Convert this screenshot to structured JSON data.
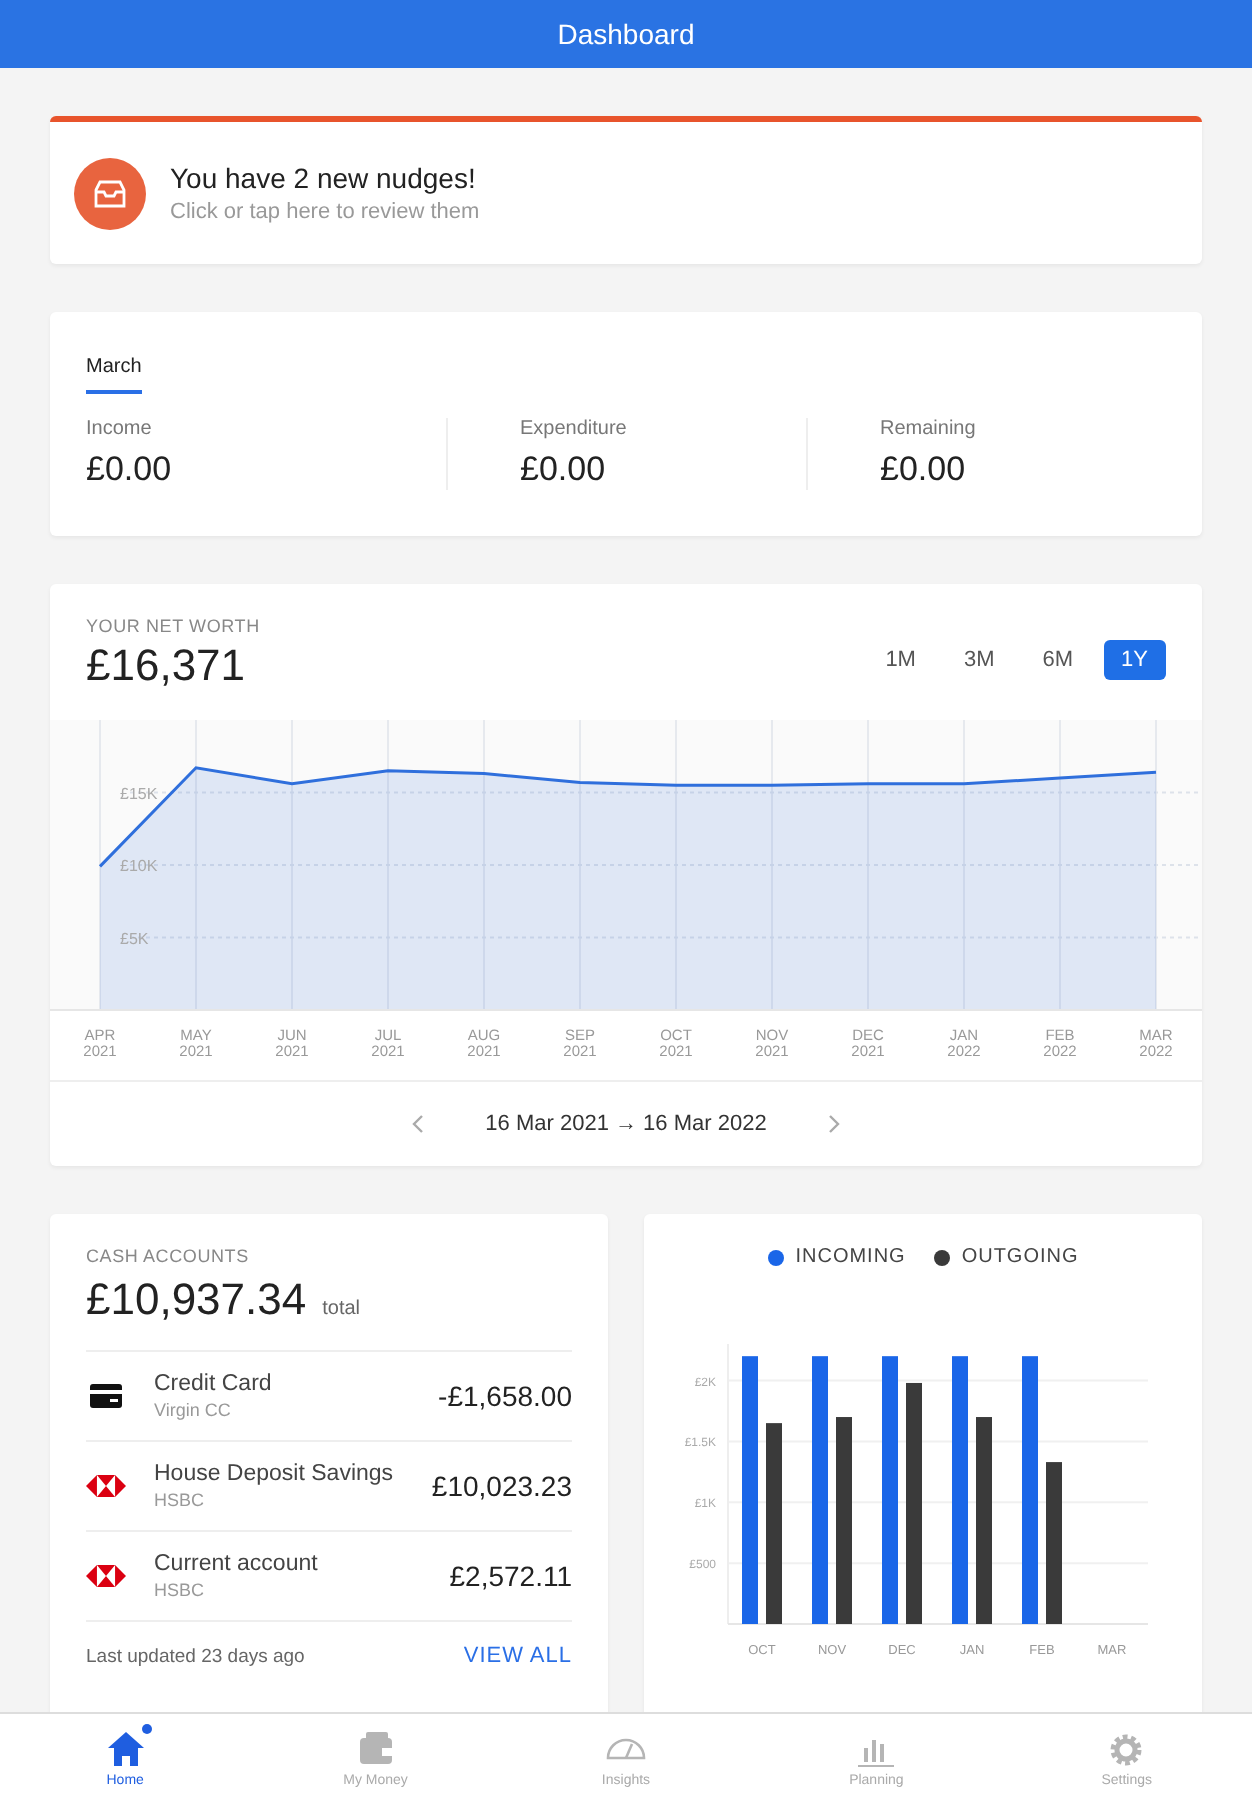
{
  "header": {
    "title": "Dashboard"
  },
  "nudge": {
    "title": "You have 2 new nudges!",
    "subtitle": "Click or tap here to review them"
  },
  "summary": {
    "tabs": [
      {
        "label": "March",
        "selected": true
      }
    ],
    "stats": [
      {
        "label": "Income",
        "value": "£0.00"
      },
      {
        "label": "Expenditure",
        "value": "£0.00"
      },
      {
        "label": "Remaining",
        "value": "£0.00"
      }
    ]
  },
  "net_worth": {
    "label": "YOUR NET WORTH",
    "value": "£16,371",
    "ranges": [
      {
        "label": "1M",
        "selected": false
      },
      {
        "label": "3M",
        "selected": false
      },
      {
        "label": "6M",
        "selected": false
      },
      {
        "label": "1Y",
        "selected": true
      }
    ],
    "chart_data": {
      "type": "area",
      "categories": [
        "APR 2021",
        "MAY 2021",
        "JUN 2021",
        "JUL 2021",
        "AUG 2021",
        "SEP 2021",
        "OCT 2021",
        "NOV 2021",
        "DEC 2021",
        "JAN 2022",
        "FEB 2022",
        "MAR 2022"
      ],
      "grid": true,
      "series": [
        {
          "color": "#2f6fdc",
          "values": [
            9900,
            16700,
            15600,
            16500,
            16300,
            15700,
            15500,
            15500,
            15600,
            15600,
            16000,
            16400
          ]
        }
      ],
      "ylim": [
        0,
        20000
      ],
      "yticks": [
        {
          "value": 5000,
          "label": "£5K"
        },
        {
          "value": 10000,
          "label": "£10K"
        },
        {
          "value": 15000,
          "label": "£15K"
        }
      ]
    },
    "date_range": "16 Mar 2021 → 16 Mar 2022"
  },
  "cash_accounts": {
    "label": "CASH ACCOUNTS",
    "total": "£10,937.34",
    "total_suffix": "total",
    "accounts": [
      {
        "kind": "card",
        "name": "Credit Card",
        "provider": "Virgin CC",
        "balance": "-£1,658.00"
      },
      {
        "kind": "bank",
        "name": "House Deposit Savings",
        "provider": "HSBC",
        "balance": "£10,023.23"
      },
      {
        "kind": "bank",
        "name": "Current account",
        "provider": "HSBC",
        "balance": "£2,572.11"
      }
    ],
    "updated": "Last updated 23 days ago",
    "link": "VIEW ALL"
  },
  "cash_flow": {
    "chart_data": {
      "type": "bar",
      "grid": true,
      "legend": "top",
      "categories": [
        "OCT",
        "NOV",
        "DEC",
        "JAN",
        "FEB",
        "MAR"
      ],
      "series": [
        {
          "name": "INCOMING",
          "color": "#1a66e8",
          "values": [
            2200,
            2200,
            2200,
            2200,
            2200,
            null
          ]
        },
        {
          "name": "OUTGOING",
          "color": "#3a3a3a",
          "values": [
            1650,
            1700,
            1980,
            1700,
            1330,
            null
          ]
        }
      ],
      "ylim": [
        0,
        2300
      ],
      "yticks": [
        {
          "value": 500,
          "label": "£500"
        },
        {
          "value": 1000,
          "label": "£1K"
        },
        {
          "value": 1500,
          "label": "£1.5K"
        },
        {
          "value": 2000,
          "label": "£2K"
        }
      ]
    }
  },
  "nav": [
    {
      "label": "Home",
      "kind": "home",
      "selected": true,
      "badge": true
    },
    {
      "label": "My Money",
      "kind": "wallet",
      "selected": false,
      "badge": false
    },
    {
      "label": "Insights",
      "kind": "gauge",
      "selected": false,
      "badge": false
    },
    {
      "label": "Planning",
      "kind": "bars",
      "selected": false,
      "badge": false
    },
    {
      "label": "Settings",
      "kind": "gear",
      "selected": false,
      "badge": false
    }
  ]
}
